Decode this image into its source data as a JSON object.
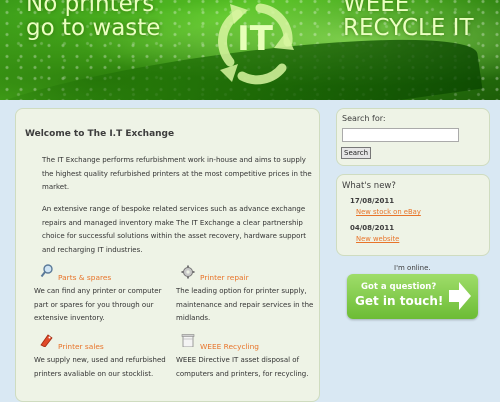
{
  "banner": {
    "slogan_left": "No printers go to waste",
    "slogan_right": "WEEE RECYCLE IT",
    "logo_text": "IT"
  },
  "main": {
    "title": "Welcome to The I.T Exchange",
    "paragraph1": "The IT Exchange performs refurbishment work in-house and aims to supply the highest quality refurbished printers at the most competitive prices in the market.",
    "paragraph2": "An extensive range of bespoke related services such as advance exchange repairs and managed inventory make The IT Exchange a clear partnership choice for successful solutions within the asset recovery, hardware support and recharging IT industries.",
    "features": [
      {
        "title": "Parts & spares",
        "text": "We can find any printer or computer part or spares for you through our extensive inventory.",
        "icon": "magnifier-icon"
      },
      {
        "title": "Printer repair",
        "text": "The leading option for printer supply, maintenance and repair services in the midlands.",
        "icon": "gear-icon"
      },
      {
        "title": "Printer sales",
        "text": "We supply new, used and refurbished printers avaliable on our stocklist.",
        "icon": "tag-icon"
      },
      {
        "title": "WEEE Recycling",
        "text": "WEEE Directive IT asset disposal of computers and printers, for recycling.",
        "icon": "recycle-bin-icon"
      }
    ]
  },
  "sidebar": {
    "search_label": "Search for:",
    "search_value": "",
    "search_button": "Search",
    "news_heading": "What's new?",
    "news": [
      {
        "date": "17/08/2011",
        "link": "New stock on eBay"
      },
      {
        "date": "04/08/2011",
        "link": "New website"
      }
    ],
    "online_status": "I'm online.",
    "cta_line1": "Got a question?",
    "cta_line2": "Get in touch!"
  },
  "colors": {
    "accent_orange": "#e8742a",
    "panel_bg": "#eef3e6",
    "page_bg": "#d9e8f3",
    "cta_green": "#7cc843"
  }
}
